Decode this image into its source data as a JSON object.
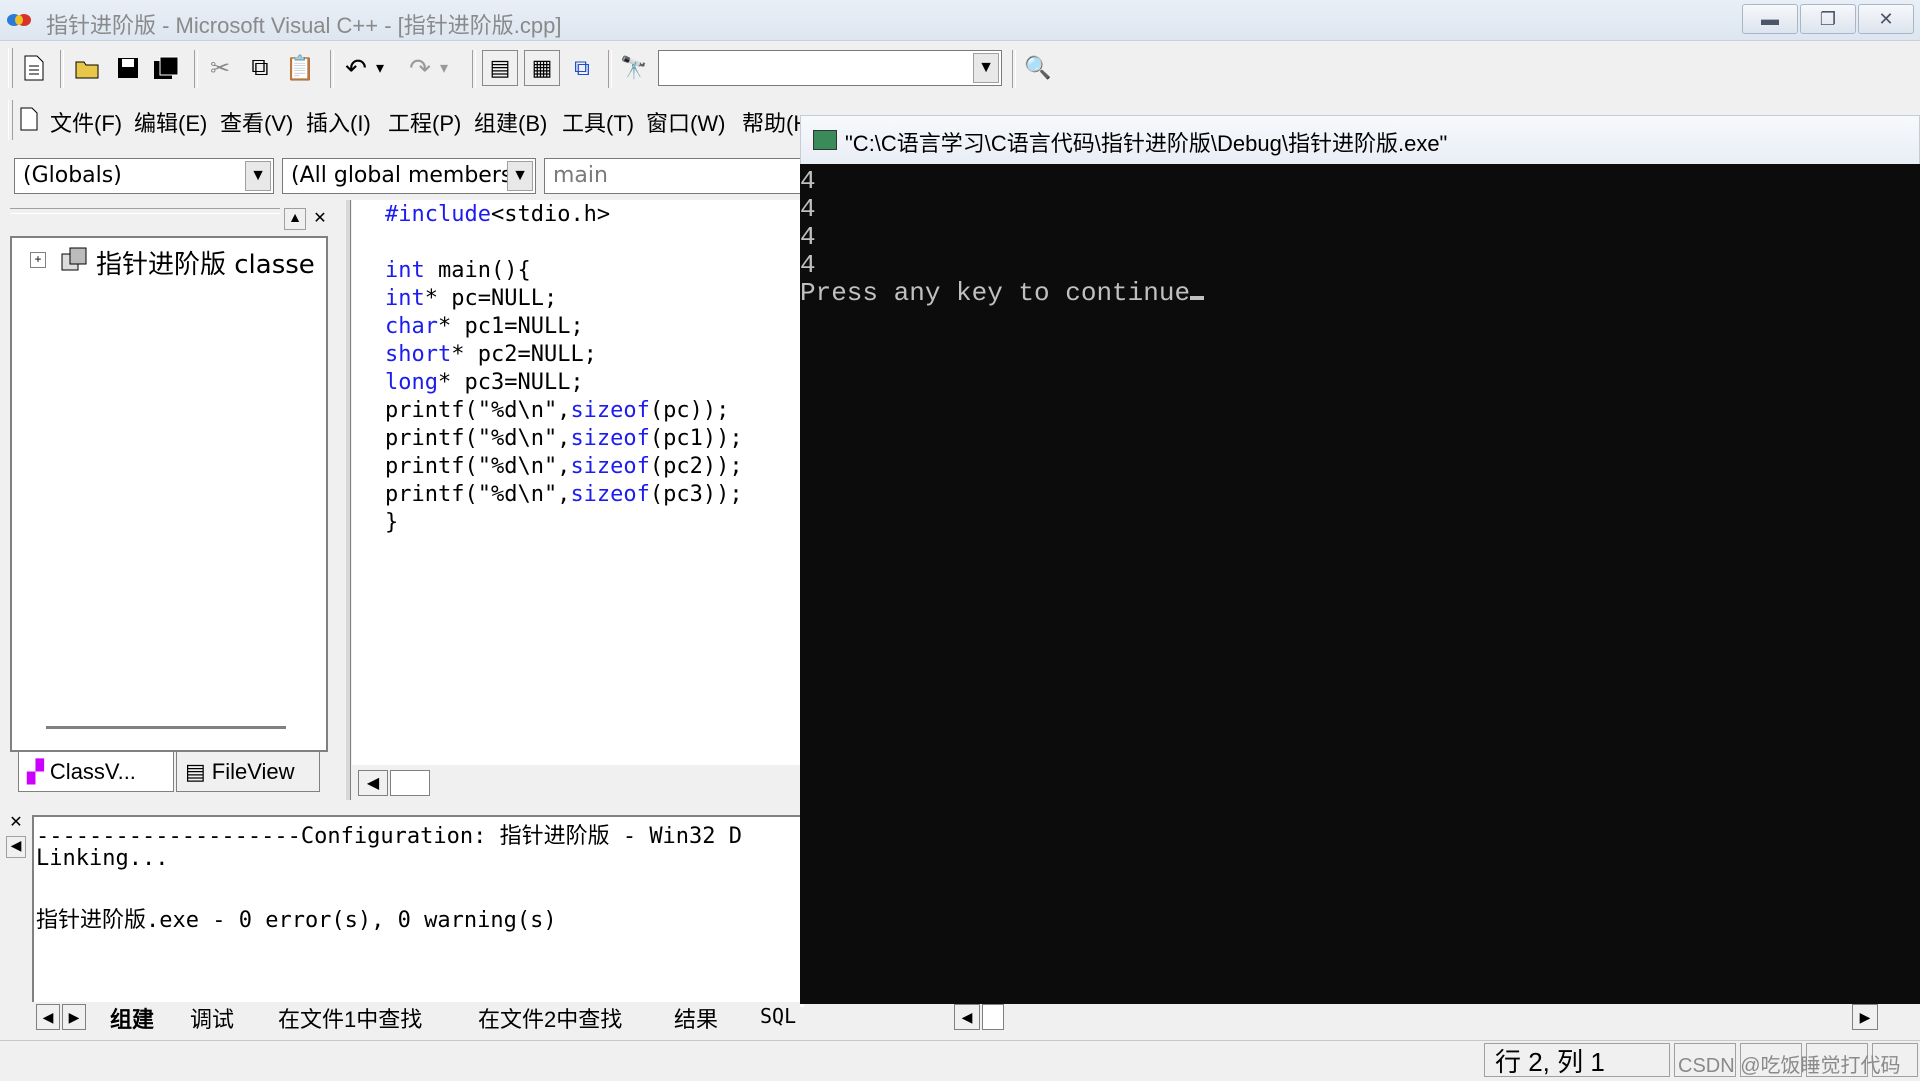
{
  "window": {
    "title": "指针进阶版 - Microsoft Visual C++ - [指针进阶版.cpp]"
  },
  "menu": {
    "items": [
      "文件(F)",
      "编辑(E)",
      "查看(V)",
      "插入(I)",
      "工程(P)",
      "组建(B)",
      "工具(T)",
      "窗口(W)",
      "帮助(H"
    ]
  },
  "combos": {
    "globals": "(Globals)",
    "members": "(All global members",
    "function": "main"
  },
  "classview": {
    "tree_item": "指针进阶版 classe",
    "tabs": [
      "ClassV...",
      "FileView"
    ]
  },
  "code": {
    "lines": [
      {
        "kw": "#include",
        "rest": "<stdio.h>"
      },
      {
        "kw": "",
        "rest": ""
      },
      {
        "kw": "int",
        "rest": " main(){"
      },
      {
        "kw": "int",
        "rest": "* pc=NULL;"
      },
      {
        "kw": "char",
        "rest": "* pc1=NULL;"
      },
      {
        "kw": "short",
        "rest": "* pc2=NULL;"
      },
      {
        "kw": "long",
        "rest": "* pc3=NULL;"
      },
      {
        "pre": "printf(\"%d\\n\",",
        "kw": "sizeof",
        "rest": "(pc));"
      },
      {
        "pre": "printf(\"%d\\n\",",
        "kw": "sizeof",
        "rest": "(pc1));"
      },
      {
        "pre": "printf(\"%d\\n\",",
        "kw": "sizeof",
        "rest": "(pc2));"
      },
      {
        "pre": "printf(\"%d\\n\",",
        "kw": "sizeof",
        "rest": "(pc3));"
      },
      {
        "kw": "",
        "rest": "}"
      }
    ]
  },
  "output": {
    "lines": [
      "--------------------Configuration: 指针进阶版 - Win32 D",
      "Linking...",
      "",
      "指针进阶版.exe - 0 error(s), 0 warning(s)"
    ],
    "tabs": [
      "组建",
      "调试",
      "在文件1中查找",
      "在文件2中查找",
      "结果",
      "SQL Debugging"
    ]
  },
  "console": {
    "title": "\"C:\\C语言学习\\C语言代码\\指针进阶版\\Debug\\指针进阶版.exe\"",
    "lines": [
      "4",
      "4",
      "4",
      "4",
      "Press any key to continue"
    ]
  },
  "status": {
    "position": "行 2, 列 1",
    "watermark": "CSDN @吃饭睡觉打代码"
  },
  "colors": {
    "keyword": "#1c1cf0",
    "console_bg": "#0c0c0c",
    "console_fg": "#c0c0c0"
  }
}
